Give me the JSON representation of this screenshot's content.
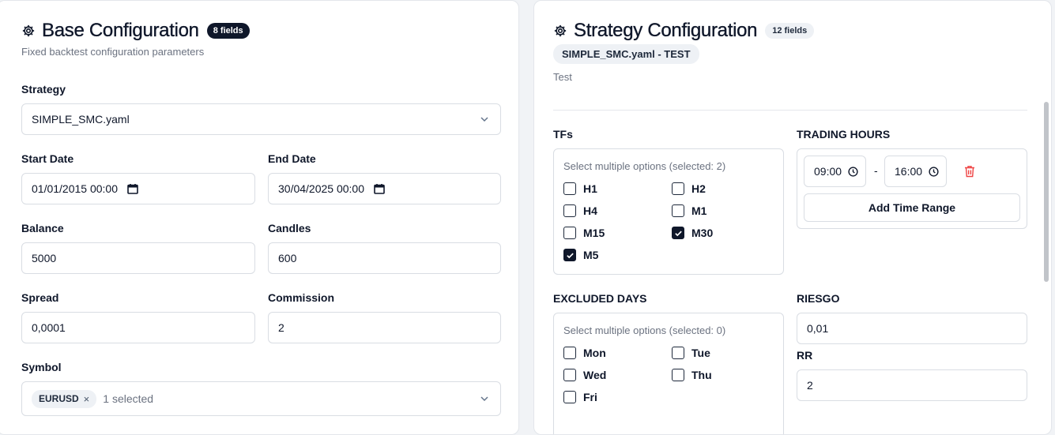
{
  "base": {
    "title": "Base Configuration",
    "badge": "8 fields",
    "subtitle": "Fixed backtest configuration parameters",
    "strategy": {
      "label": "Strategy",
      "value": "SIMPLE_SMC.yaml"
    },
    "start_date": {
      "label": "Start Date",
      "value": "01/01/2015 00:00"
    },
    "end_date": {
      "label": "End Date",
      "value": "30/04/2025 00:00"
    },
    "balance": {
      "label": "Balance",
      "value": "5000"
    },
    "candles": {
      "label": "Candles",
      "value": "600"
    },
    "spread": {
      "label": "Spread",
      "value": "0,0001"
    },
    "commission": {
      "label": "Commission",
      "value": "2"
    },
    "symbol": {
      "label": "Symbol",
      "chip": "EURUSD",
      "chip_remove": "×",
      "count": "1 selected"
    }
  },
  "strategy_config": {
    "title": "Strategy Configuration",
    "badge": "12 fields",
    "file_badge": "SIMPLE_SMC.yaml - TEST",
    "description": "Test",
    "tfs": {
      "label": "TFs",
      "hint": "Select multiple options (selected: 2)",
      "options": [
        {
          "label": "H1",
          "checked": false
        },
        {
          "label": "H2",
          "checked": false
        },
        {
          "label": "H4",
          "checked": false
        },
        {
          "label": "M1",
          "checked": false
        },
        {
          "label": "M15",
          "checked": false
        },
        {
          "label": "M30",
          "checked": true
        },
        {
          "label": "M5",
          "checked": true
        }
      ]
    },
    "trading_hours": {
      "label": "TRADING HOURS",
      "start": "09:00",
      "separator": "-",
      "end": "16:00",
      "add_button": "Add Time Range"
    },
    "excluded_days": {
      "label": "EXCLUDED DAYS",
      "hint": "Select multiple options (selected: 0)",
      "options": [
        {
          "label": "Mon",
          "checked": false
        },
        {
          "label": "Tue",
          "checked": false
        },
        {
          "label": "Wed",
          "checked": false
        },
        {
          "label": "Thu",
          "checked": false
        },
        {
          "label": "Fri",
          "checked": false
        }
      ]
    },
    "riesgo": {
      "label": "RIESGO",
      "value": "0,01"
    },
    "rr": {
      "label": "RR",
      "value": "2"
    }
  },
  "icons": {
    "gear": "gear-icon",
    "chevron": "chevron-down-icon",
    "calendar": "calendar-icon",
    "clock": "clock-icon",
    "trash": "trash-icon",
    "check": "check-icon"
  },
  "colors": {
    "primary": "#0f172a",
    "danger": "#ef4444",
    "muted": "#6b7280",
    "border": "#d9dde3"
  }
}
